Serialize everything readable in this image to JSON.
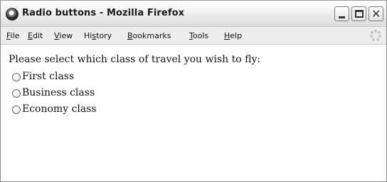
{
  "window": {
    "title": "Radio buttons - Mozilla Firefox",
    "close_glyph": "✕"
  },
  "menubar": {
    "items": [
      {
        "accel": "F",
        "rest": "ile"
      },
      {
        "accel": "E",
        "rest": "dit"
      },
      {
        "accel": "V",
        "rest": "iew"
      },
      {
        "pre": "Hi",
        "accel": "s",
        "rest": "tory"
      },
      {
        "accel": "B",
        "rest": "ookmarks"
      },
      {
        "accel": "T",
        "rest": "ools"
      },
      {
        "accel": "H",
        "rest": "elp"
      }
    ]
  },
  "page": {
    "prompt": "Please select which class of travel you wish to fly:",
    "options": [
      {
        "label": "First class",
        "checked": false
      },
      {
        "label": "Business class",
        "checked": false
      },
      {
        "label": "Economy class",
        "checked": false
      }
    ]
  },
  "icons": {
    "app": "firefox-app-icon",
    "throbber": "loading-throbber-icon"
  }
}
